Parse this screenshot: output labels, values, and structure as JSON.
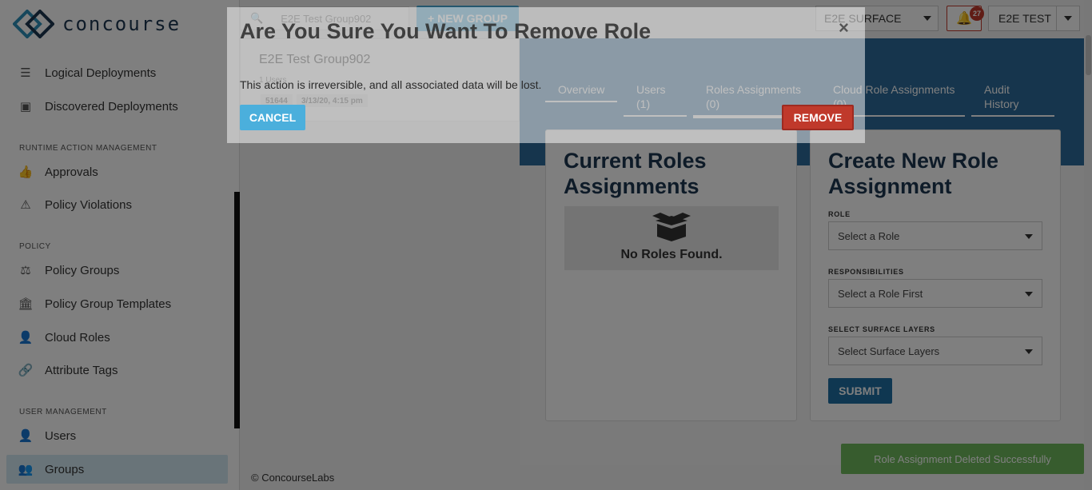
{
  "brand": {
    "name": "concourse"
  },
  "sidebar": {
    "items": [
      {
        "label": "Logical Deployments",
        "icon": "server-icon"
      },
      {
        "label": "Discovered Deployments",
        "icon": "discover-icon"
      },
      {
        "label": "Approvals",
        "icon": "thumbs-up-icon"
      },
      {
        "label": "Policy Violations",
        "icon": "warning-icon"
      },
      {
        "label": "Policy Groups",
        "icon": "scale-icon"
      },
      {
        "label": "Policy Group Templates",
        "icon": "bank-icon"
      },
      {
        "label": "Cloud Roles",
        "icon": "user-lock-icon"
      },
      {
        "label": "Attribute Tags",
        "icon": "link-icon"
      },
      {
        "label": "Users",
        "icon": "user-icon"
      },
      {
        "label": "Groups",
        "icon": "users-icon"
      }
    ],
    "sections": {
      "runtime": "RUNTIME ACTION MANAGEMENT",
      "policy": "POLICY",
      "user_management": "USER MANAGEMENT"
    },
    "footer": "© ConcourseLabs"
  },
  "topbar": {
    "search_value": "E2E Test Group902",
    "new_group_label": "+ NEW GROUP",
    "surface_value": "E2E SURFACE",
    "notification_count": "27",
    "user_value": "E2E TEST"
  },
  "group_card": {
    "name": "E2E Test Group902",
    "users_count": "1 Users",
    "id_tag": "51644",
    "date_tag": "3/13/20, 4:15 pm"
  },
  "tabs": [
    {
      "label": "Overview"
    },
    {
      "label": "Users",
      "count": "(1)"
    },
    {
      "label": "Roles Assignments",
      "count": "(0)"
    },
    {
      "label": "Cloud Role Assignments",
      "count": "(0)"
    },
    {
      "label": "Audit",
      "count": "History"
    }
  ],
  "current_roles": {
    "title_line1": "Current Roles",
    "title_line2": "Assignments",
    "empty_text": "No Roles Found."
  },
  "create_role": {
    "title_line1": "Create New Role",
    "title_line2": "Assignment",
    "role_label": "ROLE",
    "role_value": "Select a Role",
    "resp_label": "RESPONSIBILITIES",
    "resp_value": "Select a Role First",
    "layers_label": "SELECT SURFACE LAYERS",
    "layers_value": "Select Surface Layers",
    "submit_label": "SUBMIT"
  },
  "toast": {
    "message": "Role Assignment Deleted Successfully"
  },
  "modal": {
    "title": "Are You Sure You Want To Remove Role",
    "body": "This action is irreversible, and all associated data will be lost.",
    "cancel_label": "CANCEL",
    "remove_label": "REMOVE",
    "close_symbol": "×"
  },
  "colors": {
    "accent": "#4bafdc",
    "header_blue": "#1f5d8e",
    "danger": "#c0392b",
    "toast_green": "#6fb85d"
  }
}
